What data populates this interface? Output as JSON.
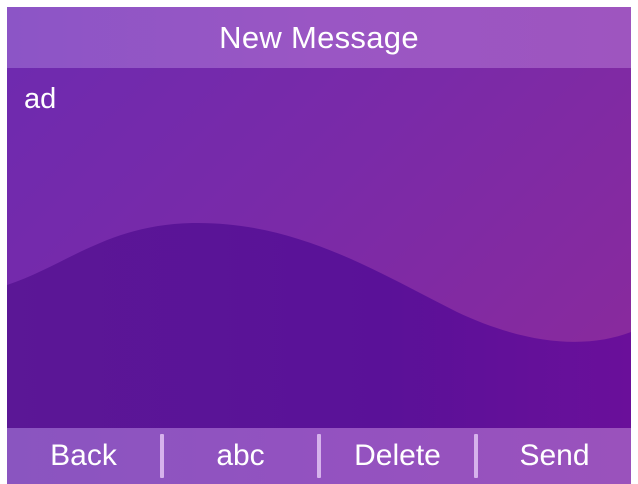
{
  "header": {
    "title": "New Message"
  },
  "message": {
    "text": "ad"
  },
  "softkeys": [
    {
      "label": "Back"
    },
    {
      "label": "abc"
    },
    {
      "label": "Delete"
    },
    {
      "label": "Send"
    }
  ],
  "colors": {
    "background_start": "#6d2ab0",
    "background_end": "#8d2a9a",
    "wave": "#5a1296",
    "bar": "#9352c0",
    "text": "#ffffff"
  }
}
